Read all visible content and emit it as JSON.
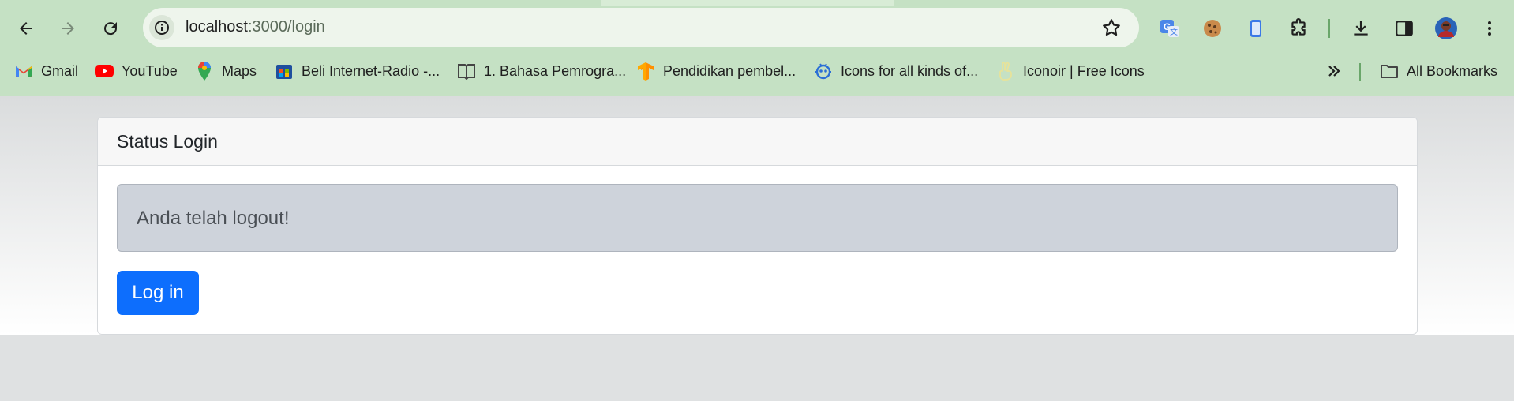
{
  "browser": {
    "url_host": "localhost",
    "url_path": ":3000/login",
    "nav": {
      "back_icon": "arrow-left-icon",
      "forward_icon": "arrow-right-icon",
      "reload_icon": "reload-icon"
    },
    "extensions": [
      "translate-icon",
      "cookie-icon",
      "phone-icon",
      "puzzle-icon",
      "download-icon",
      "sidepanel-icon",
      "avatar",
      "more-icon"
    ]
  },
  "bookmarks": {
    "items": [
      {
        "label": "Gmail",
        "icon": "gmail-icon"
      },
      {
        "label": "YouTube",
        "icon": "youtube-icon"
      },
      {
        "label": "Maps",
        "icon": "maps-icon"
      },
      {
        "label": "Beli Internet-Radio -...",
        "icon": "store-icon"
      },
      {
        "label": "1. Bahasa Pemrogra...",
        "icon": "book-icon"
      },
      {
        "label": "Pendidikan pembel...",
        "icon": "tensorflow-icon"
      },
      {
        "label": "Icons for all kinds of...",
        "icon": "robot-icon"
      },
      {
        "label": "Iconoir | Free Icons",
        "icon": "peace-hand-icon"
      }
    ],
    "all_bookmarks_label": "All Bookmarks"
  },
  "card": {
    "title": "Status Login",
    "alert_text": "Anda telah logout!",
    "login_button": "Log in"
  },
  "colors": {
    "chrome": "#c5e1c4",
    "primary_button": "#0d6efd",
    "alert_bg": "#ced3db"
  }
}
